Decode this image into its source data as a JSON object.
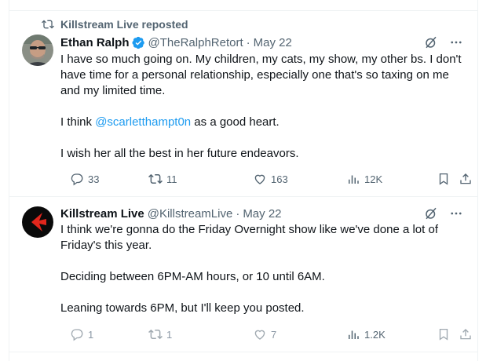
{
  "timeline": {
    "tweets": [
      {
        "repost_text": "Killstream Live reposted",
        "author_name": "Ethan Ralph",
        "author_handle": "@TheRalphRetort",
        "separator": "·",
        "date": "May 22",
        "verified": true,
        "paragraphs": [
          "I have so much going on. My children, my cats, my show, my other bs. I don't have time for a personal relationship, especially one that's so taxing on me and my limited time.",
          {
            "before": "I think ",
            "mention": "@scarletthampt0n",
            "after": " as a good heart."
          },
          "I wish her all the best in her future endeavors."
        ],
        "counts": {
          "replies": "33",
          "reposts": "11",
          "likes": "163",
          "views": "12K"
        }
      },
      {
        "author_name": "Killstream Live",
        "author_handle": "@KillstreamLive",
        "separator": "·",
        "date": "May 22",
        "verified": false,
        "paragraphs": [
          "I think we're gonna do the Friday Overnight show like we've done a lot of Friday's this year.",
          "Deciding between 6PM-AM hours, or 10 until 6AM.",
          "Leaning towards 6PM, but I'll keep you posted."
        ],
        "counts": {
          "replies": "1",
          "reposts": "1",
          "likes": "7",
          "views": "1.2K"
        }
      }
    ]
  },
  "icons": {
    "repost": "repost-icon",
    "verified": "verified-badge-icon",
    "grok": "grok-icon",
    "more": "more-icon",
    "reply": "reply-icon",
    "like": "like-icon",
    "views": "views-icon",
    "bookmark": "bookmark-icon",
    "share": "share-icon"
  },
  "colors": {
    "accent": "#1d9bf0",
    "secondary_text": "#536471",
    "primary_text": "#0f1419",
    "border": "#eff3f4"
  }
}
